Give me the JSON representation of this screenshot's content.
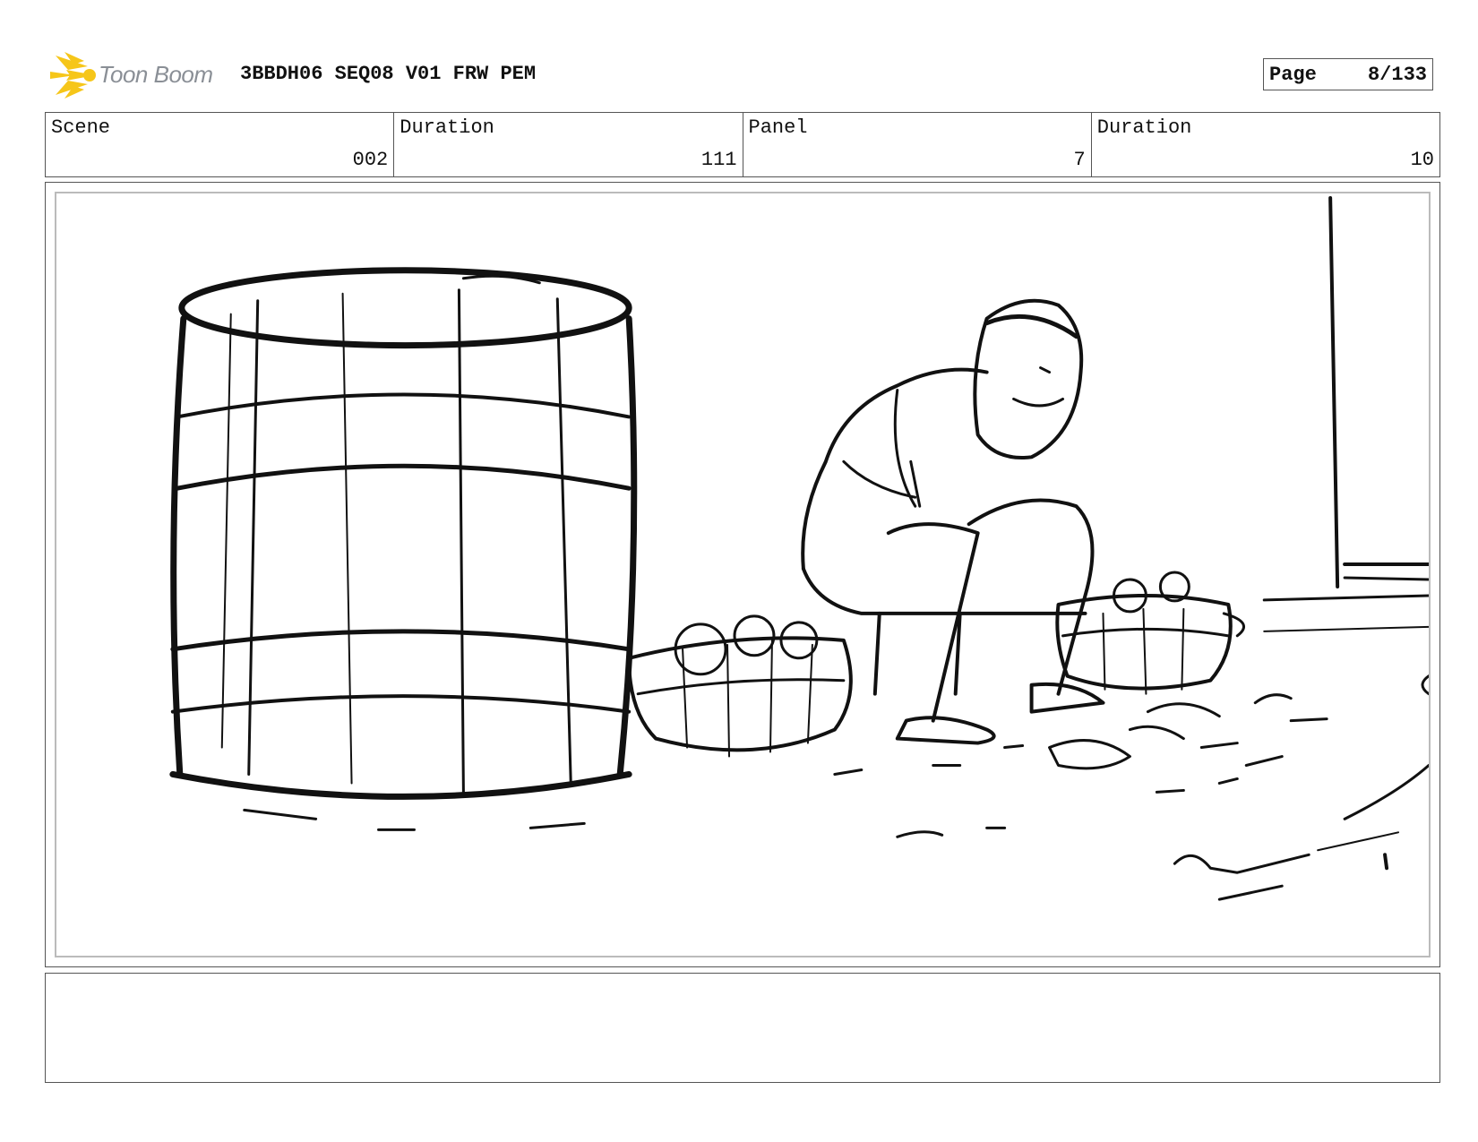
{
  "header": {
    "logo_text": "Toon Boom",
    "logo_icon": "starburst-logo-icon",
    "project_title": "3BBDH06 SEQ08 V01 FRW PEM",
    "page_label": "Page",
    "page_value": "8/133"
  },
  "info": {
    "scene_label": "Scene",
    "scene_value": "002",
    "scene_duration_label": "Duration",
    "scene_duration_value": "111",
    "panel_label": "Panel",
    "panel_value": "7",
    "panel_duration_label": "Duration",
    "panel_duration_value": "10"
  },
  "panel": {
    "content": "storyboard sketch"
  },
  "notes": {
    "text": ""
  },
  "colors": {
    "logo_accent": "#f6c619",
    "border": "#555555",
    "ink": "#111111"
  }
}
